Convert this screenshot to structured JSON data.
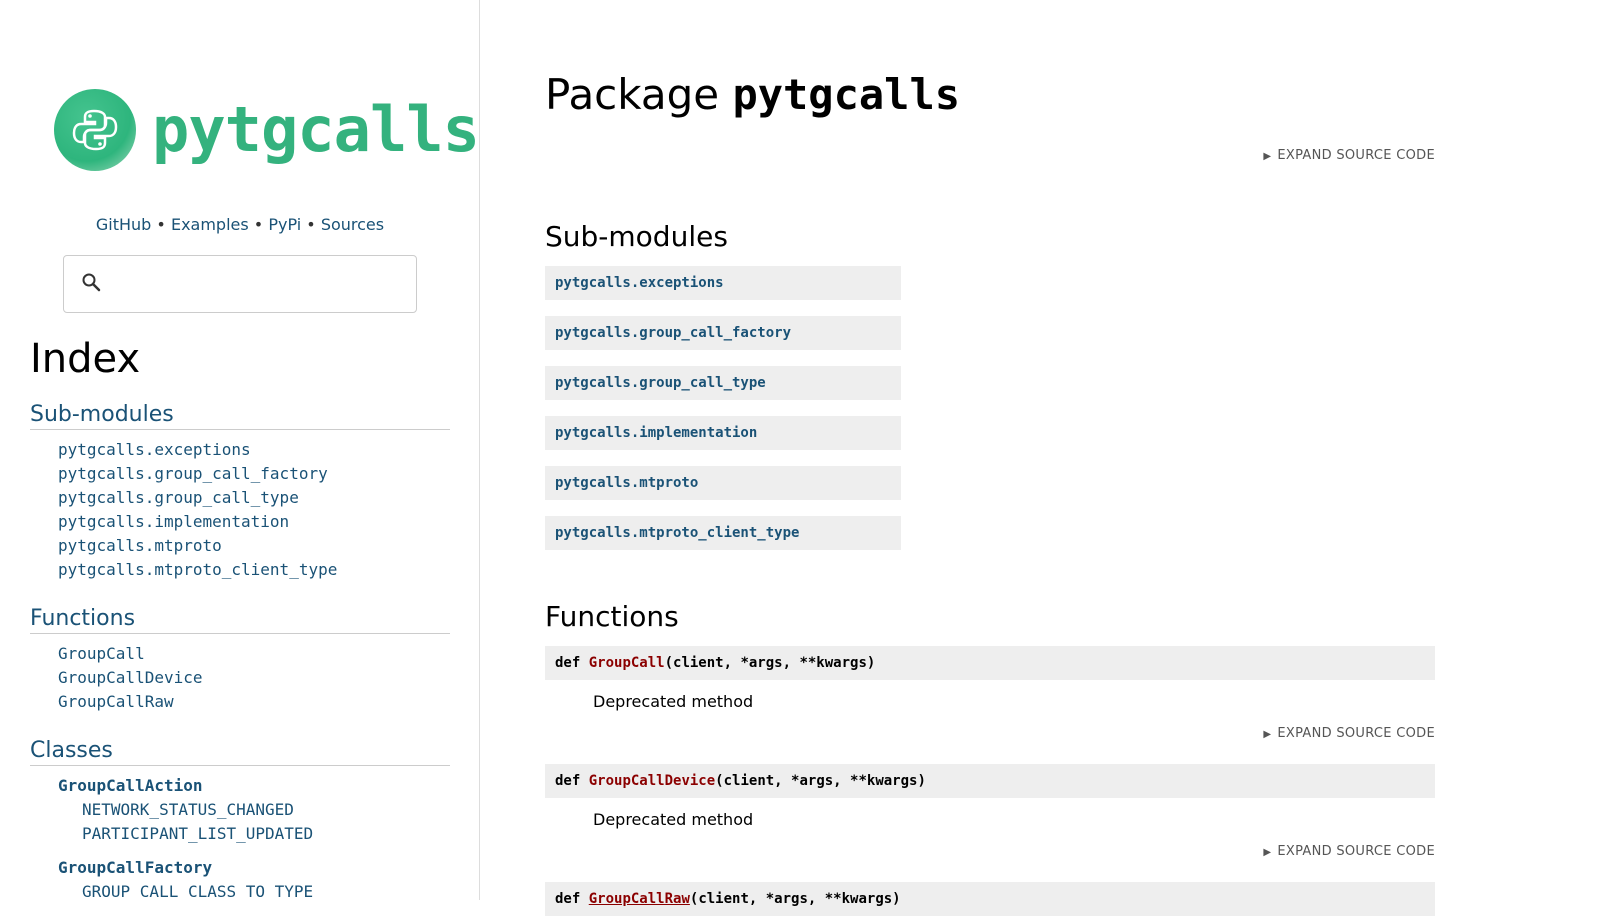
{
  "sidebar": {
    "logo_text": "pytgcalls",
    "links": [
      "GitHub",
      "Examples",
      "PyPi",
      "Sources"
    ],
    "separator": "•",
    "search": {
      "value": "",
      "placeholder": ""
    },
    "index_title": "Index",
    "submodules_heading": "Sub-modules",
    "submodules": [
      "pytgcalls.exceptions",
      "pytgcalls.group_call_factory",
      "pytgcalls.group_call_type",
      "pytgcalls.implementation",
      "pytgcalls.mtproto",
      "pytgcalls.mtproto_client_type"
    ],
    "functions_heading": "Functions",
    "functions": [
      "GroupCall",
      "GroupCallDevice",
      "GroupCallRaw"
    ],
    "classes_heading": "Classes",
    "classes": [
      {
        "name": "GroupCallAction",
        "members": [
          "NETWORK_STATUS_CHANGED",
          "PARTICIPANT_LIST_UPDATED"
        ]
      },
      {
        "name": "GroupCallFactory",
        "members": [
          "GROUP_CALL_CLASS_TO_TYPE"
        ]
      }
    ]
  },
  "main": {
    "title_prefix": "Package",
    "title_name": "pytgcalls",
    "expand_label": "EXPAND SOURCE CODE",
    "submodules_heading": "Sub-modules",
    "submodules": [
      "pytgcalls.exceptions",
      "pytgcalls.group_call_factory",
      "pytgcalls.group_call_type",
      "pytgcalls.implementation",
      "pytgcalls.mtproto",
      "pytgcalls.mtproto_client_type"
    ],
    "functions_heading": "Functions",
    "functions": [
      {
        "keyword": "def",
        "name": "GroupCall",
        "params": "(client, *args, **kwargs)",
        "description": "Deprecated method"
      },
      {
        "keyword": "def",
        "name": "GroupCallDevice",
        "params": "(client, *args, **kwargs)",
        "description": "Deprecated method"
      },
      {
        "keyword": "def",
        "name": "GroupCallRaw",
        "params": "(client, *args, **kwargs)",
        "description": ""
      }
    ]
  },
  "colors": {
    "link": "#1a5276",
    "func_name": "#8b0000",
    "logo": "#34b27e",
    "code_bg": "#eeeeee"
  },
  "icons": {
    "search": "search-icon",
    "logo": "python-logo-icon",
    "expand": "triangle-right-icon"
  }
}
